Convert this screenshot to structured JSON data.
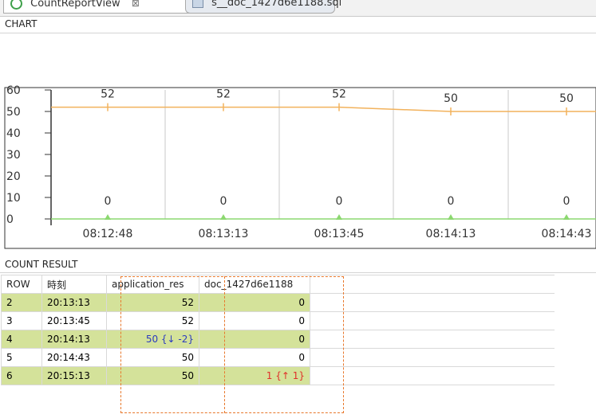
{
  "tabs": [
    {
      "label": "CountReportView",
      "close": "⊠",
      "icon": "view-icon"
    },
    {
      "label": "s__doc_1427d6e1188.sql",
      "icon": "sql-file-icon"
    }
  ],
  "chart_section": {
    "title": "CHART"
  },
  "chart_data": {
    "type": "line",
    "categories": [
      "08:12:48",
      "08:13:13",
      "08:13:45",
      "08:14:13",
      "08:14:43"
    ],
    "series": [
      {
        "values": [
          52,
          52,
          52,
          50,
          50
        ],
        "color": "#f2b25c",
        "labels": [
          "52",
          "52",
          "52",
          "50",
          "50"
        ]
      },
      {
        "values": [
          0,
          0,
          0,
          0,
          0
        ],
        "color": "#8cd870",
        "labels": [
          "0",
          "0",
          "0",
          "0",
          "0"
        ]
      }
    ],
    "yticks": [
      "60",
      "50",
      "40",
      "30",
      "20",
      "10",
      "0"
    ],
    "ylim": [
      0,
      60
    ],
    "grid": true
  },
  "result_section": {
    "title": "COUNT RESULT"
  },
  "table": {
    "headers": [
      "ROW",
      "時刻",
      "application_res",
      "doc_1427d6e1188"
    ],
    "rows": [
      {
        "row": "2",
        "time": "20:13:13",
        "app": "52",
        "doc": "0"
      },
      {
        "row": "3",
        "time": "20:13:45",
        "app": "52",
        "doc": "0"
      },
      {
        "row": "4",
        "time": "20:14:13",
        "app": "50 {↓ -2}",
        "doc": "0"
      },
      {
        "row": "5",
        "time": "20:14:43",
        "app": "50",
        "doc": "0"
      },
      {
        "row": "6",
        "time": "20:15:13",
        "app": "50",
        "doc": "1 {↑ 1}"
      }
    ]
  },
  "colors": {
    "highlight_row": "#d4e29a",
    "dash_border": "#e8782c",
    "down": "#2b3bbf",
    "up": "#e0302a"
  }
}
